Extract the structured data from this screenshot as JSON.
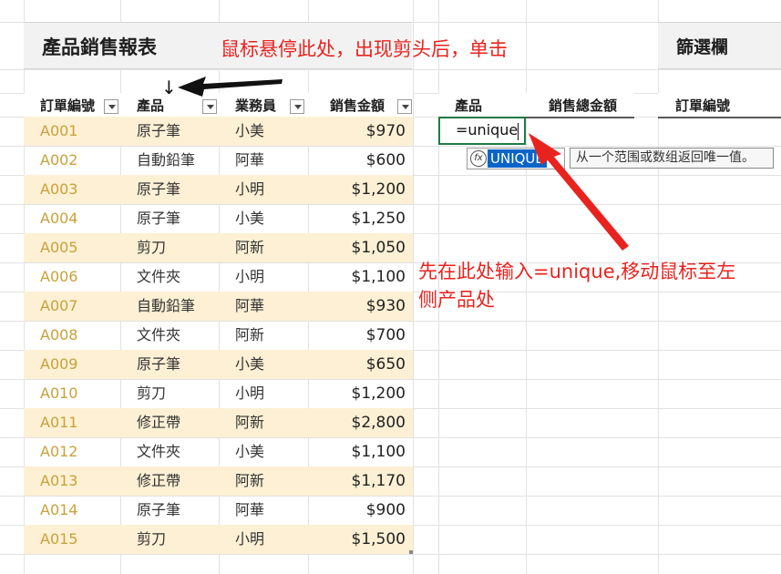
{
  "report": {
    "title": "產品銷售報表",
    "headers": {
      "order_id": "訂單編號",
      "product": "產品",
      "rep": "業務員",
      "amount": "銷售金額"
    },
    "rows": [
      {
        "id": "A001",
        "product": "原子筆",
        "rep": "小美",
        "amount": "$970"
      },
      {
        "id": "A002",
        "product": "自動鉛筆",
        "rep": "阿華",
        "amount": "$600"
      },
      {
        "id": "A003",
        "product": "原子筆",
        "rep": "小明",
        "amount": "$1,200"
      },
      {
        "id": "A004",
        "product": "原子筆",
        "rep": "小美",
        "amount": "$1,250"
      },
      {
        "id": "A005",
        "product": "剪刀",
        "rep": "阿新",
        "amount": "$1,050"
      },
      {
        "id": "A006",
        "product": "文件夾",
        "rep": "小明",
        "amount": "$1,100"
      },
      {
        "id": "A007",
        "product": "自動鉛筆",
        "rep": "阿華",
        "amount": "$930"
      },
      {
        "id": "A008",
        "product": "文件夾",
        "rep": "阿新",
        "amount": "$700"
      },
      {
        "id": "A009",
        "product": "原子筆",
        "rep": "小美",
        "amount": "$650"
      },
      {
        "id": "A010",
        "product": "剪刀",
        "rep": "小明",
        "amount": "$1,200"
      },
      {
        "id": "A011",
        "product": "修正帶",
        "rep": "阿新",
        "amount": "$2,800"
      },
      {
        "id": "A012",
        "product": "文件夾",
        "rep": "小美",
        "amount": "$1,100"
      },
      {
        "id": "A013",
        "product": "修正帶",
        "rep": "阿新",
        "amount": "$1,170"
      },
      {
        "id": "A014",
        "product": "原子筆",
        "rep": "阿華",
        "amount": "$900"
      },
      {
        "id": "A015",
        "product": "剪刀",
        "rep": "小明",
        "amount": "$1,500"
      }
    ]
  },
  "summary": {
    "product_header": "產品",
    "total_header": "銷售總金額"
  },
  "filter": {
    "title": "篩選欄",
    "header": "訂單編號"
  },
  "editor": {
    "formula": "=unique",
    "autocomplete_label": "UNIQUE",
    "autocomplete_icon": "fx",
    "tooltip": "从一个范围或数组返回唯一值。"
  },
  "annotations": {
    "top": "鼠标悬停此处，出现剪头后，单击",
    "bottom_line1": "先在此处输入=unique,移动鼠标至左",
    "bottom_line2": "侧产品处",
    "down_arrow": "↓",
    "color": "#e8231f"
  }
}
